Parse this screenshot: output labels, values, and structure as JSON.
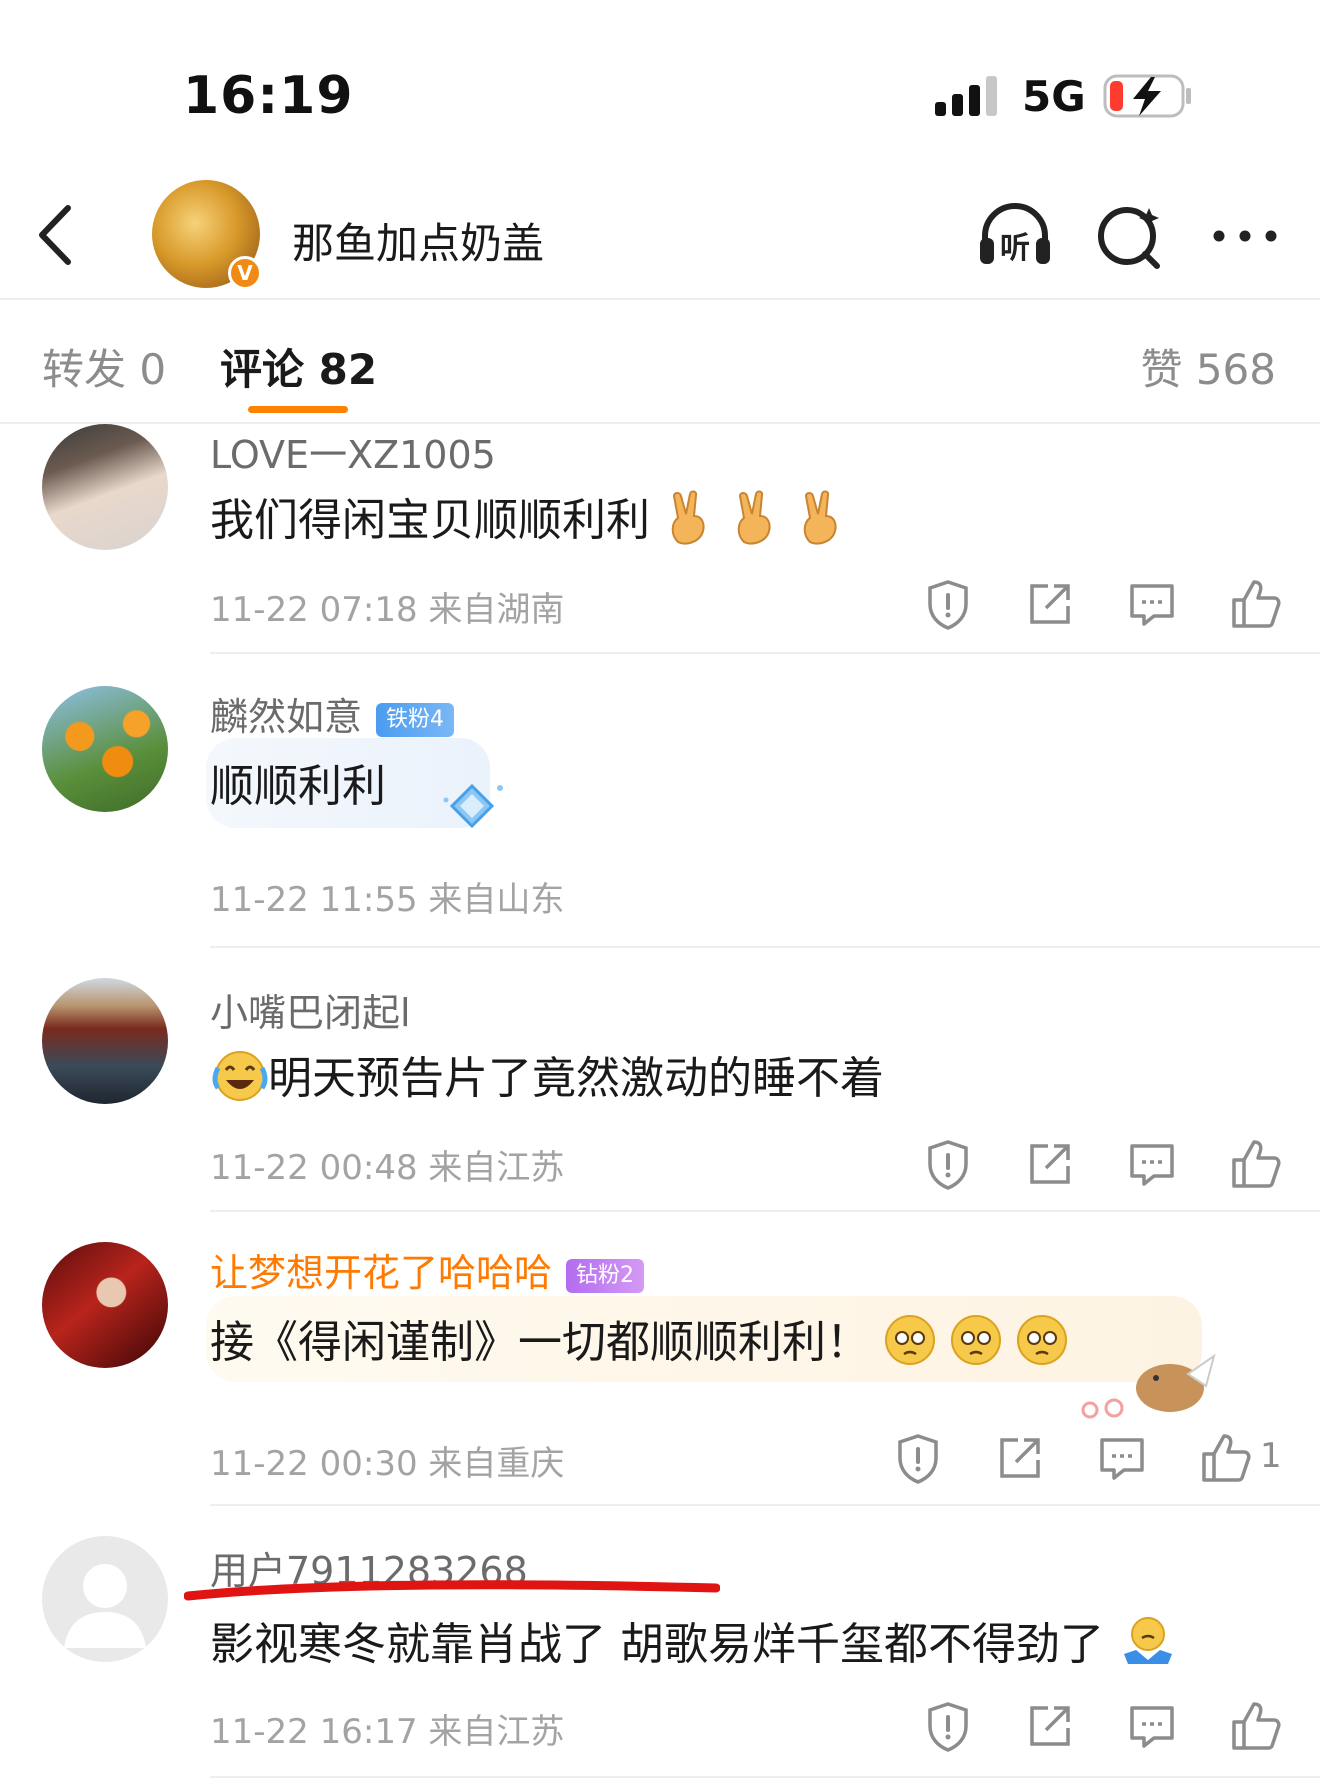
{
  "status_bar": {
    "time": "16:19",
    "network": "5G"
  },
  "header": {
    "title": "那鱼加点奶盖",
    "verified_mark": "V",
    "icons": [
      "back-icon",
      "listen-icon",
      "search-icon",
      "more-icon"
    ],
    "listen_label": "听"
  },
  "tabs": [
    {
      "label": "转发 0"
    },
    {
      "label": "评论 82"
    },
    {
      "label": "赞 568"
    }
  ],
  "accent_color": "#ff8200",
  "comments": [
    {
      "user": "LOVE一XZ1005",
      "text": "我们得闲宝贝顺顺利利",
      "emoji": "victory-hand",
      "meta": "11-22 07:18  来自湖南"
    },
    {
      "user": "麟然如意",
      "badge": "铁粉4",
      "text": "顺顺利利",
      "meta": "11-22 11:55  来自山东"
    },
    {
      "user": "小嘴巴闭起l",
      "text": "明天预告片了竟然激动的睡不着",
      "emoji": "laugh-cry",
      "meta": "11-22 00:48  来自江苏"
    },
    {
      "user": "让梦想开花了哈哈哈",
      "badge": "钻粉2",
      "text": "接《得闲谨制》一切都顺顺利利！",
      "emoji": "pleading-face",
      "meta": "11-22 00:30  来自重庆",
      "likes": "1"
    },
    {
      "user": "用户7911283268",
      "text": "影视寒冬就靠肖战了   胡歌易烊千玺都不得劲了",
      "emoji": "shrug",
      "meta": "11-22 16:17  来自江苏"
    }
  ]
}
